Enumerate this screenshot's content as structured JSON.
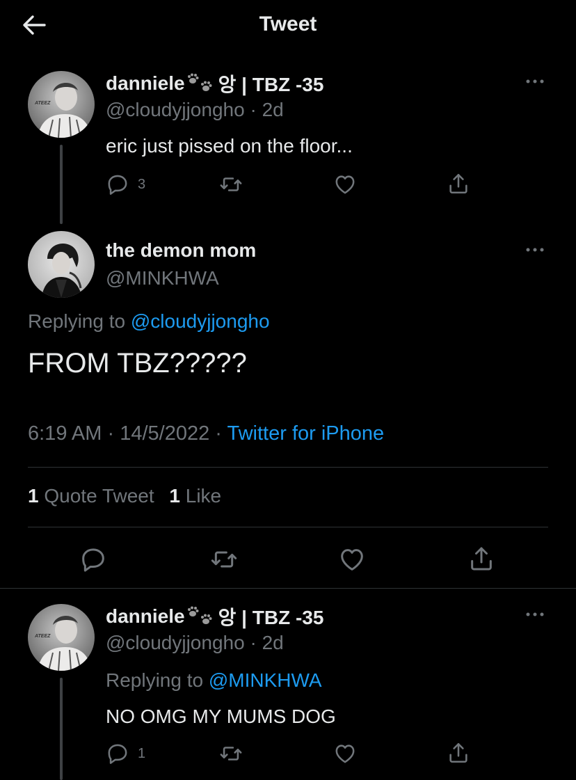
{
  "header": {
    "title": "Tweet"
  },
  "tweets": [
    {
      "name": "danniele",
      "name_suffix": "앙 | TBZ -35",
      "handle": "@cloudyjjongho",
      "separator": "·",
      "time": "2d",
      "text": "eric just pissed on the floor...",
      "reply_count": "3"
    },
    {
      "name": "the demon mom",
      "handle": "@MINKHWA",
      "replying_prefix": "Replying to ",
      "replying_to": "@cloudyjjongho",
      "text": "FROM TBZ?????",
      "time": "6:19 AM",
      "separator": "·",
      "date": "14/5/2022",
      "source": "Twitter for iPhone",
      "quote_count": "1",
      "quote_label": "Quote Tweet",
      "like_count": "1",
      "like_label": "Like"
    },
    {
      "name": "danniele",
      "name_suffix": "앙 | TBZ -35",
      "handle": "@cloudyjjongho",
      "separator": "·",
      "time": "2d",
      "replying_prefix": "Replying to ",
      "replying_to": "@MINKHWA",
      "text": "NO OMG MY MUMS DOG",
      "reply_count": "1"
    }
  ],
  "icons": {
    "back": "arrow-left-icon",
    "more": "more-icon",
    "reply": "reply-icon",
    "retweet": "retweet-icon",
    "like": "heart-icon",
    "share": "share-icon",
    "paw": "paw-prints-icon"
  },
  "colors": {
    "accent": "#1d9bf0",
    "background": "#000000",
    "text": "#e7e9ea",
    "muted": "#71767b"
  }
}
